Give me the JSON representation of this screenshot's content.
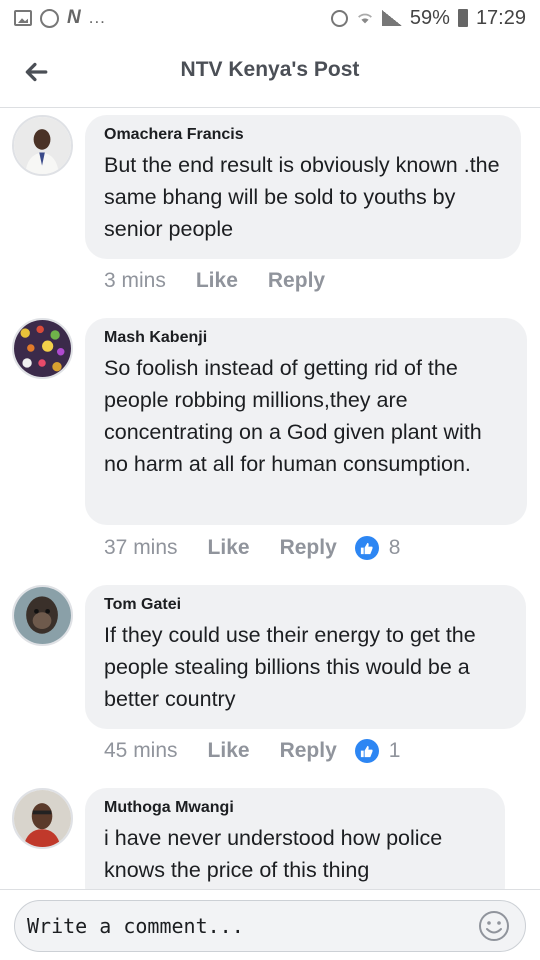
{
  "status_bar": {
    "battery": "59%",
    "time": "17:29",
    "icons": [
      "gallery-icon",
      "whatsapp-icon",
      "n-icon",
      "more-dots-icon",
      "alarm-icon",
      "wifi-icon",
      "signal-icon",
      "battery-icon"
    ]
  },
  "header": {
    "title": "NTV Kenya's Post",
    "back_icon": "arrow-left-icon"
  },
  "comments": [
    {
      "author": "Omachera Francis",
      "text": "But the end result is obviously known .the same bhang will be sold to youths by senior people",
      "time": "3 mins",
      "like_label": "Like",
      "reply_label": "Reply",
      "reactions": null
    },
    {
      "author": "Mash Kabenji",
      "text": "So foolish instead of getting rid of the people robbing millions,they are concentrating on a God given plant with no harm at all for human consumption.",
      "time": "37 mins",
      "like_label": "Like",
      "reply_label": "Reply",
      "reactions": "8"
    },
    {
      "author": "Tom Gatei",
      "text": "If they could use their energy to get the people stealing billions this would be a better country",
      "time": "45 mins",
      "like_label": "Like",
      "reply_label": "Reply",
      "reactions": "1"
    },
    {
      "author": "Muthoga Mwangi",
      "text": "i have never understood how police knows the price of this thing",
      "time": "",
      "like_label": "",
      "reply_label": "",
      "reactions": null
    }
  ],
  "composer": {
    "placeholder": "Write a comment...",
    "emoji_icon": "smiley-icon"
  },
  "colors": {
    "bubble": "#f0f1f3",
    "meta_text": "#90949c",
    "like_badge": "#2d86f3"
  }
}
